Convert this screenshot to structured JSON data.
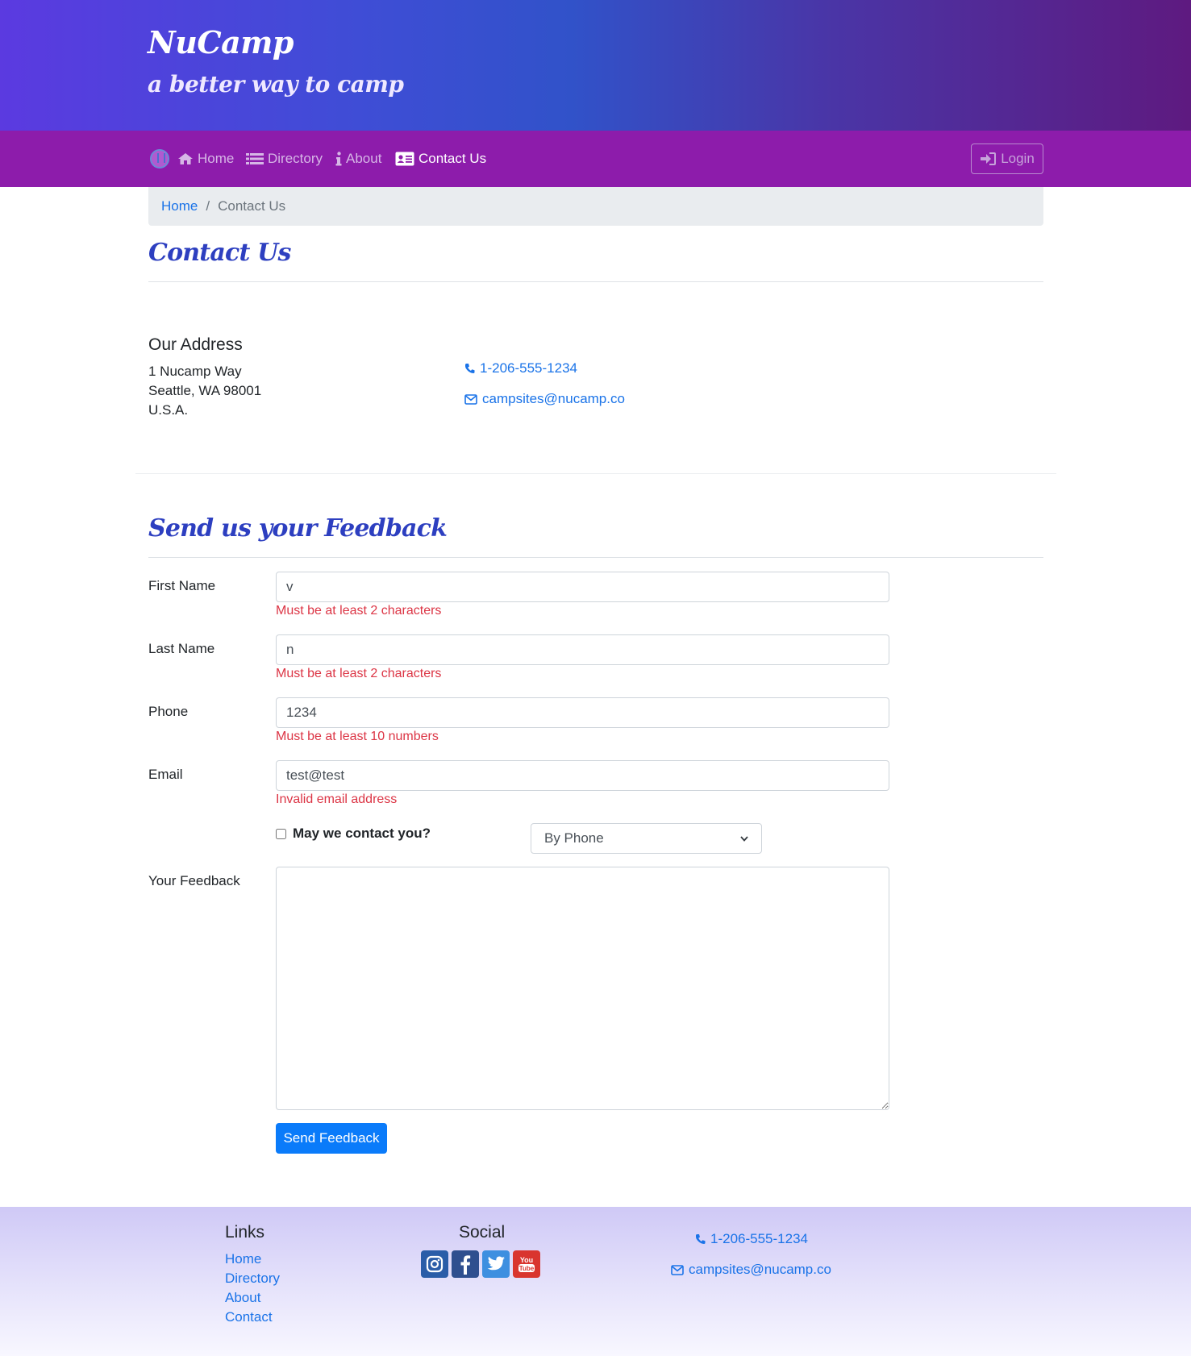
{
  "header": {
    "brand": "NuCamp",
    "tagline": "a better way to camp"
  },
  "nav": {
    "items": [
      {
        "label": "Home",
        "icon": "home-icon"
      },
      {
        "label": "Directory",
        "icon": "list-icon"
      },
      {
        "label": "About",
        "icon": "info-icon"
      },
      {
        "label": "Contact Us",
        "icon": "address-card-icon",
        "active": true
      }
    ],
    "login_label": "Login"
  },
  "breadcrumb": {
    "home": "Home",
    "separator": "/",
    "current": "Contact Us"
  },
  "page_title": "Contact Us",
  "address": {
    "heading": "Our Address",
    "line1": "1 Nucamp Way",
    "line2": "Seattle, WA 98001",
    "line3": "U.S.A.",
    "phone": "1-206-555-1234",
    "email": "campsites@nucamp.co"
  },
  "feedback": {
    "title": "Send us your Feedback",
    "first_name": {
      "label": "First Name",
      "value": "v",
      "error": "Must be at least 2 characters"
    },
    "last_name": {
      "label": "Last Name",
      "value": "n",
      "error": "Must be at least 2 characters"
    },
    "phone": {
      "label": "Phone",
      "value": "1234",
      "error": "Must be at least 10 numbers"
    },
    "email": {
      "label": "Email",
      "value": "test@test",
      "error": "Invalid email address"
    },
    "contact_checkbox": "May we contact you?",
    "contact_type": "By Phone",
    "feedback_label": "Your Feedback",
    "feedback_value": "",
    "submit": "Send Feedback"
  },
  "footer": {
    "links_heading": "Links",
    "links": [
      "Home",
      "Directory",
      "About",
      "Contact"
    ],
    "social_heading": "Social",
    "social_icons": [
      "instagram-icon",
      "facebook-icon",
      "twitter-icon",
      "youtube-icon"
    ],
    "phone": "1-206-555-1234",
    "email": "campsites@nucamp.co"
  },
  "colors": {
    "navbar": "#8d1cab",
    "title": "#2d3fc0",
    "link": "#1a73e8",
    "error": "#dc3545",
    "primary_button": "#0a7bfa"
  }
}
